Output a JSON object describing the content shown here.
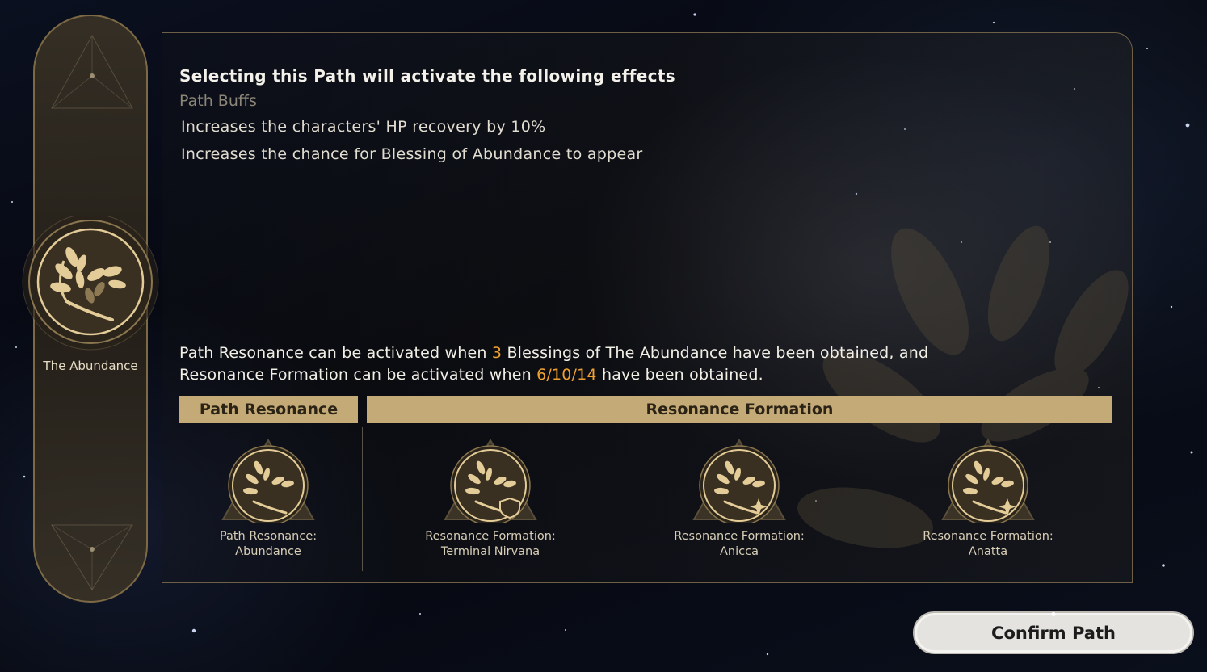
{
  "sidebar": {
    "path_name": "The Abundance",
    "emblem_icon": "abundance-laurel-icon"
  },
  "effects": {
    "title": "Selecting this Path will activate the following effects",
    "buffs_heading": "Path Buffs",
    "buffs": [
      "Increases the characters' HP recovery by 10%",
      "Increases the chance for Blessing of Abundance to appear"
    ]
  },
  "resonance": {
    "line1_a": "Path Resonance can be activated when ",
    "line1_count": "3",
    "line1_b": " Blessings of The Abundance have been obtained, and",
    "line2_a": "Resonance Formation can be activated when ",
    "line2_counts": "6/10/14",
    "line2_b": " have been obtained.",
    "path_resonance_header": "Path Resonance",
    "formation_header": "Resonance Formation",
    "items": [
      {
        "line1": "Path Resonance:",
        "line2": "Abundance",
        "badge": "none"
      },
      {
        "line1": "Resonance Formation:",
        "line2": "Terminal Nirvana",
        "badge": "shield-icon"
      },
      {
        "line1": "Resonance Formation:",
        "line2": "Anicca",
        "badge": "star-icon"
      },
      {
        "line1": "Resonance Formation:",
        "line2": "Anatta",
        "badge": "star-icon"
      }
    ]
  },
  "confirm_button": "Confirm Path",
  "colors": {
    "highlight": "#f0a032",
    "header_bar": "#c4aa76",
    "gold": "#e3cc97"
  }
}
